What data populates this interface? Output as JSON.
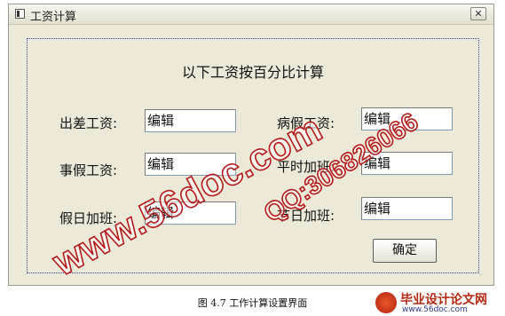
{
  "window": {
    "title": "工资计算",
    "close_symbol": "✕"
  },
  "form": {
    "heading": "以下工资按百分比计算",
    "fields": [
      {
        "label": "出差工资:",
        "value": "编辑"
      },
      {
        "label": "病假工资:",
        "value": "编辑"
      },
      {
        "label": "事假工资:",
        "value": "编辑"
      },
      {
        "label": "平时加班:",
        "value": "编辑"
      },
      {
        "label": "假日加班:",
        "value": "编辑"
      },
      {
        "label": "节日加班:",
        "value": "编辑"
      }
    ],
    "ok_label": "确定"
  },
  "caption": "图 4.7 工作计算设置界面",
  "watermarks": {
    "url": "www.56doc.com",
    "qq": "QQ:306826066"
  },
  "corner_logo": {
    "title": "毕业设计论文网",
    "url": "www.56doc.com"
  }
}
